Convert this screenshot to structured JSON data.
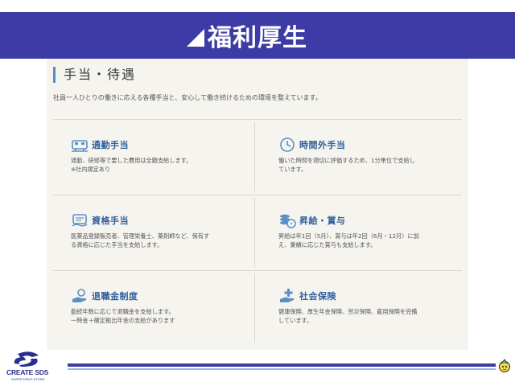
{
  "banner": {
    "title": "福利厚生"
  },
  "section": {
    "heading": "手当・待遇",
    "description": "社員一人ひとりの働きに応える各種手当と、安心して働き続けるための環境を整えています。"
  },
  "benefits": [
    {
      "icon": "train-icon",
      "title": "通勤手当",
      "lines": [
        "通勤、研修等で要した費用は全額支給します。",
        "※社内規定あり"
      ]
    },
    {
      "icon": "clock-icon",
      "title": "時間外手当",
      "lines": [
        "働いた時間を適切に評価するため、1分単位で支給し",
        "ています。"
      ]
    },
    {
      "icon": "license-card-icon",
      "title": "資格手当",
      "lines": [
        "医薬品登録販売者、管理栄養士、薬剤師など、保有す",
        "る資格に応じた手当を支給します。"
      ]
    },
    {
      "icon": "coins-icon",
      "title": "昇給・賞与",
      "lines": [
        "昇給は年1回（5月）、賞与は年2回（6月・12月）に加",
        "え、業績に応じた賞与も支給します。"
      ]
    },
    {
      "icon": "hand-coin-icon",
      "title": "退職金制度",
      "lines": [
        "勤続年数に応じて退職金を支給します。",
        "一時金＋確定拠出年金の支給があります"
      ]
    },
    {
      "icon": "hand-plus-icon",
      "title": "社会保険",
      "lines": [
        "健康保険、厚生年金保険、労災保険、雇用保険を完備",
        "しています。"
      ]
    }
  ],
  "footer": {
    "logo_text": "CREATE SDS",
    "logo_sub": "SUPER DRUG STORE"
  },
  "colors": {
    "banner": "#3d3ca6",
    "accent": "#2f5f9c",
    "panel": "#f5f4ef"
  }
}
